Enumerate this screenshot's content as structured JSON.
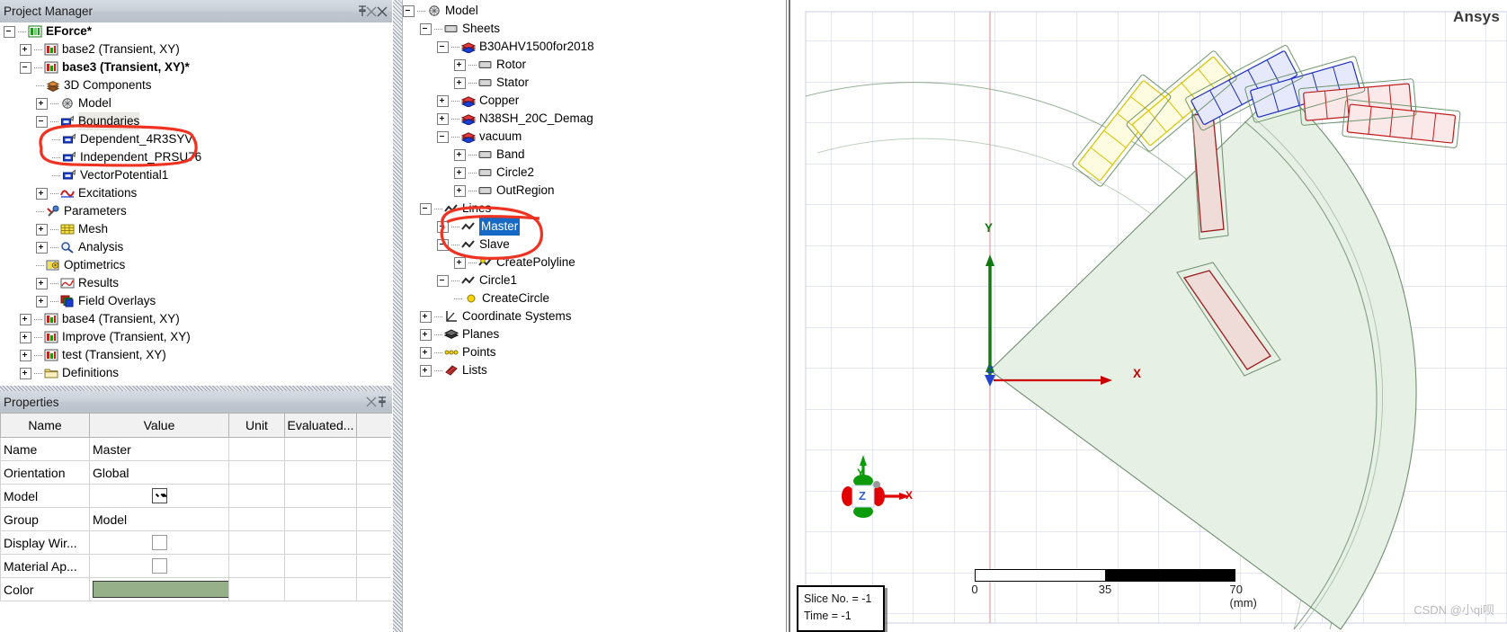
{
  "project_manager": {
    "title": "Project Manager",
    "pin_icon": "pin-icon",
    "close_icon": "close-icon",
    "tree": [
      {
        "label": "EForce*",
        "depth": 0,
        "expander": "minus",
        "icon": "project-icon",
        "bold": true
      },
      {
        "label": "base2 (Transient, XY)",
        "depth": 1,
        "expander": "plus",
        "icon": "design-icon",
        "bold": false
      },
      {
        "label": "base3 (Transient, XY)*",
        "depth": 1,
        "expander": "minus",
        "icon": "design-icon",
        "bold": true
      },
      {
        "label": "3D Components",
        "depth": 2,
        "expander": "none",
        "icon": "components-icon",
        "bold": false
      },
      {
        "label": "Model",
        "depth": 2,
        "expander": "plus",
        "icon": "model-icon",
        "bold": false
      },
      {
        "label": "Boundaries",
        "depth": 2,
        "expander": "minus",
        "icon": "boundary-icon",
        "bold": false,
        "highlight": true
      },
      {
        "label": "Dependent_4R3SYV",
        "depth": 3,
        "expander": "none",
        "icon": "boundary-icon",
        "bold": false
      },
      {
        "label": "Independent_PRSU76",
        "depth": 3,
        "expander": "none",
        "icon": "boundary-icon",
        "bold": false
      },
      {
        "label": "VectorPotential1",
        "depth": 3,
        "expander": "none",
        "icon": "boundary-icon",
        "bold": false
      },
      {
        "label": "Excitations",
        "depth": 2,
        "expander": "plus",
        "icon": "excitation-icon",
        "bold": false
      },
      {
        "label": "Parameters",
        "depth": 2,
        "expander": "none",
        "icon": "parameters-icon",
        "bold": false
      },
      {
        "label": "Mesh",
        "depth": 2,
        "expander": "plus",
        "icon": "mesh-icon",
        "bold": false
      },
      {
        "label": "Analysis",
        "depth": 2,
        "expander": "plus",
        "icon": "analysis-icon",
        "bold": false
      },
      {
        "label": "Optimetrics",
        "depth": 2,
        "expander": "none",
        "icon": "optimetrics-icon",
        "bold": false
      },
      {
        "label": "Results",
        "depth": 2,
        "expander": "plus",
        "icon": "results-icon",
        "bold": false
      },
      {
        "label": "Field Overlays",
        "depth": 2,
        "expander": "plus",
        "icon": "field-overlays-icon",
        "bold": false
      },
      {
        "label": "base4 (Transient, XY)",
        "depth": 1,
        "expander": "plus",
        "icon": "design-icon",
        "bold": false
      },
      {
        "label": "Improve (Transient, XY)",
        "depth": 1,
        "expander": "plus",
        "icon": "design-icon",
        "bold": false
      },
      {
        "label": "test (Transient, XY)",
        "depth": 1,
        "expander": "plus",
        "icon": "design-icon",
        "bold": false
      },
      {
        "label": "Definitions",
        "depth": 1,
        "expander": "plus",
        "icon": "folder-icon",
        "bold": false
      }
    ]
  },
  "properties": {
    "title": "Properties",
    "pin_icon": "pin-icon",
    "close_icon": "close-icon",
    "columns": [
      "Name",
      "Value",
      "Unit",
      "Evaluated..."
    ],
    "rows": [
      {
        "name": "Name",
        "value": "Master",
        "kind": "text",
        "unit": "",
        "evaluated": ""
      },
      {
        "name": "Orientation",
        "value": "Global",
        "kind": "text",
        "unit": "",
        "evaluated": ""
      },
      {
        "name": "Model",
        "value": "",
        "kind": "checkbox-checked",
        "unit": "",
        "evaluated": ""
      },
      {
        "name": "Group",
        "value": "Model",
        "kind": "text",
        "unit": "",
        "evaluated": ""
      },
      {
        "name": "Display Wir...",
        "value": "",
        "kind": "checkbox-unchecked",
        "unit": "",
        "evaluated": ""
      },
      {
        "name": "Material Ap...",
        "value": "",
        "kind": "checkbox-unchecked",
        "unit": "",
        "evaluated": ""
      },
      {
        "name": "Color",
        "value": "",
        "kind": "color",
        "color": "#96b089",
        "unit": "",
        "evaluated": ""
      }
    ]
  },
  "model_tree": {
    "close_icon": "close-icon",
    "items": [
      {
        "label": "Model",
        "depth": 0,
        "expander": "minus",
        "icon": "model-icon"
      },
      {
        "label": "Sheets",
        "depth": 1,
        "expander": "minus",
        "icon": "sheet-icon"
      },
      {
        "label": "B30AHV1500for2018",
        "depth": 2,
        "expander": "minus",
        "icon": "material-icon"
      },
      {
        "label": "Rotor",
        "depth": 3,
        "expander": "plus",
        "icon": "sheet-icon"
      },
      {
        "label": "Stator",
        "depth": 3,
        "expander": "plus",
        "icon": "sheet-icon"
      },
      {
        "label": "Copper",
        "depth": 2,
        "expander": "plus",
        "icon": "material-icon"
      },
      {
        "label": "N38SH_20C_Demag",
        "depth": 2,
        "expander": "plus",
        "icon": "material-icon"
      },
      {
        "label": "vacuum",
        "depth": 2,
        "expander": "minus",
        "icon": "material-icon"
      },
      {
        "label": "Band",
        "depth": 3,
        "expander": "plus",
        "icon": "sheet-icon"
      },
      {
        "label": "Circle2",
        "depth": 3,
        "expander": "plus",
        "icon": "sheet-icon"
      },
      {
        "label": "OutRegion",
        "depth": 3,
        "expander": "plus",
        "icon": "sheet-icon"
      },
      {
        "label": "Lines",
        "depth": 1,
        "expander": "minus",
        "icon": "line-icon"
      },
      {
        "label": "Master",
        "depth": 2,
        "expander": "plus",
        "icon": "line-icon",
        "selected": true
      },
      {
        "label": "Slave",
        "depth": 2,
        "expander": "minus",
        "icon": "line-icon"
      },
      {
        "label": "CreatePolyline",
        "depth": 3,
        "expander": "plus",
        "icon": "polyline-icon"
      },
      {
        "label": "Circle1",
        "depth": 2,
        "expander": "minus",
        "icon": "line-icon"
      },
      {
        "label": "CreateCircle",
        "depth": 3,
        "expander": "none",
        "icon": "circle-icon"
      },
      {
        "label": "Coordinate Systems",
        "depth": 1,
        "expander": "plus",
        "icon": "coordinate-systems-icon"
      },
      {
        "label": "Planes",
        "depth": 1,
        "expander": "plus",
        "icon": "planes-icon"
      },
      {
        "label": "Points",
        "depth": 1,
        "expander": "plus",
        "icon": "points-icon"
      },
      {
        "label": "Lists",
        "depth": 1,
        "expander": "plus",
        "icon": "lists-icon"
      }
    ]
  },
  "viewport": {
    "logo": "Ansys",
    "watermark": "CSDN @小qi呗",
    "axis_labels": {
      "x": "X",
      "y": "Y",
      "z": "Z"
    },
    "triad_labels": {
      "x": "X",
      "y": "Y",
      "z": "Z"
    },
    "slice_info": {
      "slice_no": "Slice No. = -1",
      "time": "Time = -1"
    },
    "scale_bar": {
      "ticks": [
        "0",
        "35",
        "70 (mm)"
      ]
    },
    "colors": {
      "axis_x": "#dd0000",
      "axis_y": "#008000",
      "axis_z": "#2244cc",
      "grid": "#c9cde6",
      "sector_fill": "#e4eee2",
      "annotation_red": "#ee3322"
    }
  }
}
